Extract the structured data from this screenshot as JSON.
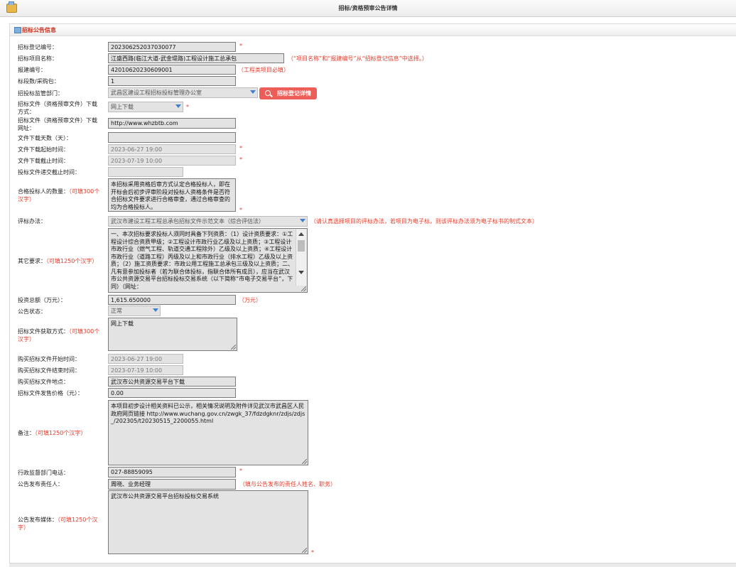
{
  "window": {
    "title": "招标/资格预审公告详情"
  },
  "section": {
    "title": "招标公告信息"
  },
  "button": {
    "label": "招标登记详情"
  },
  "required_mark": "*",
  "fields": {
    "reg_no": {
      "label": "招标登记编号：",
      "value": "202306252037030077"
    },
    "project_name": {
      "label": "招标项目名称：",
      "value": "江盛西路(临江大道-武金堤路)工程设计施工总承包",
      "note": "（“项目名称”和“报建编号”从“招标登记信息”中选择。）"
    },
    "build_no": {
      "label": "报建编号：",
      "value": "42010620230609001",
      "note": "（工程类项目必填）"
    },
    "sections": {
      "label": "标段数/采购包：",
      "value": "1"
    },
    "dept": {
      "label": "招投标监管部门：",
      "value": "武昌区建设工程招标投标管理办公室"
    },
    "download_mode": {
      "label_l1": "招标文件（资格预审文件）下载",
      "label_l2": "方式：",
      "value": "网上下载"
    },
    "download_url": {
      "label_l1": "招标文件（资格预审文件）下载",
      "label_l2": "网址：",
      "value": "http://www.whzbtb.com"
    },
    "download_days": {
      "label": "文件下载天数（天）：",
      "value": ""
    },
    "download_start": {
      "label": "文件下载起始时间：",
      "value": "2023-06-27 19:00"
    },
    "download_end": {
      "label": "文件下载截止时间：",
      "value": "2023-07-19 10:00"
    },
    "bid_deadline": {
      "label": "投标文件递交截止时间：",
      "value": ""
    },
    "qualified_count": {
      "label_l1": "合格投标人的数量：",
      "red_l1": "（可填300个",
      "red_l2": "汉字）",
      "value": "本招标采用资格后审方式认定合格投标人，即在开标会后初步评审阶段对投标人资格条件是否符合招标文件要求进行合格审查，通过合格审查的均为合格投标人。"
    },
    "eval_method": {
      "label": "评标办法：",
      "value": "武汉市建设工程工程总承包招标文件示范文本（综合评估法）",
      "note": "（请认真选择项目的评标办法，若项目为电子标，则该评标办法须为电子标书的制式文本）"
    },
    "other_req": {
      "label": "其它要求：",
      "red": "（可填1250个汉字）",
      "value": "一、本次招标要求投标人须同时具备下列资质：（1）设计资质要求：①工程设计综合资质甲级；②工程设计市政行业乙级及以上资质；③工程设计市政行业（燃气工程、轨道交通工程除外）乙级及以上资质；④工程设计市政行业（道路工程）丙级及以上和市政行业（排水工程）乙级及以上资质；（2）施工资质要求：市政公用工程施工总承包三级及以上资质；二、凡有意参加投标者（若为联合体投标，指联合体所有成员），应当在武汉市公共资源交易平台招标投标交易系统（以下简称“市电子交易平台”，下同）（网址："
    },
    "investment": {
      "label": "投资总额（万元）：",
      "value": "1,615.650000",
      "note": "（万元）"
    },
    "status": {
      "label": "公告状态：",
      "value": "正常"
    },
    "obtain_mode": {
      "label_l1": "招标文件获取方式：",
      "red_l1": "（可填300个",
      "red_l2": "汉字）",
      "value": "网上下载"
    },
    "buy_start": {
      "label": "购买招标文件开始时间：",
      "value": "2023-06-27 19:00"
    },
    "buy_end": {
      "label": "购买招标文件结束时间：",
      "value": "2023-07-19 10:00"
    },
    "buy_place": {
      "label": "购买招标文件地点：",
      "value": "武汉市公共资源交易平台下载"
    },
    "price": {
      "label": "招标文件发售价格（元）：",
      "value": "0.00"
    },
    "remark": {
      "label": "备注：",
      "red": "（可填1250个汉字）",
      "value": "本项目初步设计相关资料已公示，相关情况说明及附件详见武汉市武昌区人民政府网页链接 http://www.wuchang.gov.cn/zwgk_37/fdzdgknr/zdjs/zdjs_/202305/t20230515_2200055.html"
    },
    "phone": {
      "label": "行政监督部门电话：",
      "value": "027-88859095"
    },
    "publisher": {
      "label": "公告发布责任人：",
      "value": "周晓、业务经理",
      "note": "（填与公告发布的责任人姓名、职务）"
    },
    "media": {
      "label_l1": "公告发布媒体：",
      "red_l1": "（可填1250个汉",
      "red_l2": "字）",
      "value": "武汉市公共资源交易平台招标投标交易系统"
    }
  }
}
